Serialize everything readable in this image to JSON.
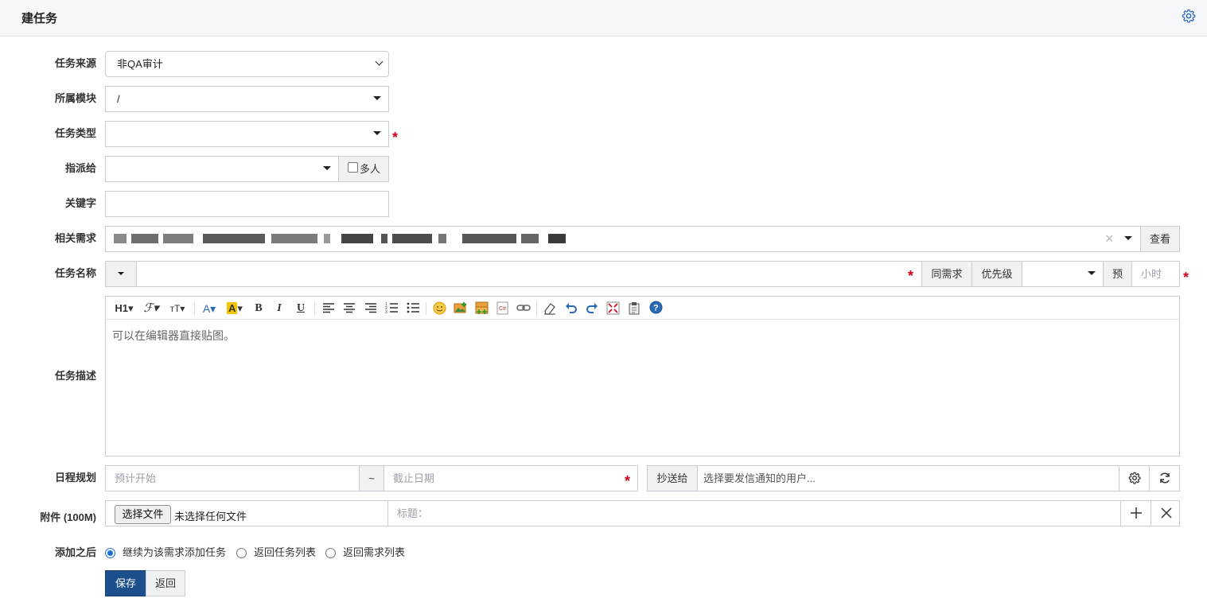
{
  "page": {
    "title": "建任务"
  },
  "form": {
    "source": {
      "label": "任务来源",
      "value": "非QA审计"
    },
    "module": {
      "label": "所属模块",
      "value": "/"
    },
    "type": {
      "label": "任务类型",
      "value": ""
    },
    "assign": {
      "label": "指派给",
      "value": "",
      "multi_label": "多人",
      "multi_checked": false
    },
    "keyword": {
      "label": "关键字",
      "value": ""
    },
    "story": {
      "label": "相关需求",
      "view_button": "查看",
      "clear": "×"
    },
    "name": {
      "label": "任务名称",
      "value": "",
      "same_story_button": "同需求",
      "priority_label": "优先级",
      "priority_value": "",
      "estimate_label": "预",
      "estimate_placeholder": "小时"
    },
    "desc": {
      "label": "任务描述",
      "placeholder": "可以在编辑器直接贴图。"
    },
    "schedule": {
      "label": "日程规划",
      "start_placeholder": "预计开始",
      "separator": "~",
      "deadline_placeholder": "截止日期",
      "mailto_label": "抄送给",
      "mailto_placeholder": "选择要发信通知的用户..."
    },
    "files": {
      "label": "附件 (100M)",
      "choose_button": "选择文件",
      "no_file": "未选择任何文件",
      "title_placeholder": "标题："
    },
    "after": {
      "label": "添加之后",
      "options": [
        {
          "label": "继续为该需求添加任务",
          "checked": true
        },
        {
          "label": "返回任务列表",
          "checked": false
        },
        {
          "label": "返回需求列表",
          "checked": false
        }
      ]
    },
    "required_mark": "*"
  },
  "editor": {
    "tools": [
      "heading-icon",
      "font-family-icon",
      "font-size-icon",
      "font-color-icon",
      "highlight-icon",
      "bold-icon",
      "italic-icon",
      "underline-icon",
      "align-left-icon",
      "align-center-icon",
      "align-right-icon",
      "ordered-list-icon",
      "bullet-list-icon",
      "emoji-icon",
      "image-icon",
      "multi-image-icon",
      "template-icon",
      "link-icon",
      "clear-format-icon",
      "undo-icon",
      "redo-icon",
      "fullscreen-icon",
      "paste-icon",
      "help-icon"
    ],
    "heading_text": "H1",
    "bold_text": "B",
    "italic_text": "I",
    "underline_text": "U"
  },
  "actions": {
    "save": "保存",
    "back": "返回"
  },
  "colors": {
    "primary": "#1d4f8c",
    "required": "#d0021b",
    "accent_icon": "#2a69b7"
  }
}
